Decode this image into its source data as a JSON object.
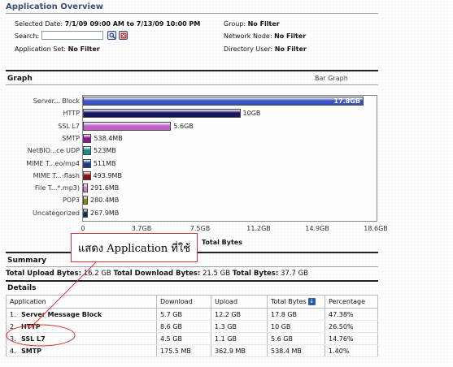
{
  "header": {
    "title": "Application Overview"
  },
  "filters": {
    "selected_date_label": "Selected Date:",
    "selected_date_value": "7/1/09 09:00 AM to 7/13/09 10:00 PM",
    "group_label": "Group:",
    "group_value": "No Filter",
    "search_label": "Search:",
    "search_value": "",
    "network_node_label": "Network Node:",
    "network_node_value": "No Filter",
    "application_set_label": "Application Set:",
    "application_set_value": "No Filter",
    "directory_user_label": "Directory User:",
    "directory_user_value": "No Filter"
  },
  "graph_section": {
    "title": "Graph",
    "view_option": "Bar Graph"
  },
  "chart_data": {
    "type": "bar",
    "orientation": "horizontal",
    "categories": [
      "Server... Block",
      "HTTP",
      "SSL L7",
      "SMTP",
      "NetBIO...ce UDP",
      "MIME T...eo/mp4",
      "MIME T...-flash",
      "File T...*.mp3)",
      "POP3",
      "Uncategorized"
    ],
    "values_gb": [
      17.8,
      10.0,
      5.6,
      0.5384,
      0.523,
      0.511,
      0.4939,
      0.2916,
      0.2804,
      0.2679
    ],
    "value_labels": [
      "17.8GB",
      "10GB",
      "5.6GB",
      "538.4MB",
      "523MB",
      "511MB",
      "493.9MB",
      "291.6MB",
      "280.4MB",
      "267.9MB"
    ],
    "colors": [
      "#3b52c4",
      "#16165e",
      "#c060c8",
      "#8a1a8a",
      "#178c8c",
      "#1a3a8a",
      "#8a1010",
      "#d080d0",
      "#8a8a10",
      "#102a55"
    ],
    "xticks": [
      "0",
      "3.7GB",
      "7.5GB",
      "11.2GB",
      "14.9GB",
      "18.6GB"
    ],
    "xlim": [
      0,
      18.6
    ],
    "xlabel": "Total Bytes",
    "ylabel": ""
  },
  "callout": {
    "text": "แสดง Application ที่ใช้",
    "border_color": "#e03030"
  },
  "summary": {
    "title": "Summary",
    "upload_label": "Total Upload Bytes:",
    "upload_value": "16.2 GB",
    "download_label": "Total Download Bytes:",
    "download_value": "21.5 GB",
    "total_label": "Total Bytes:",
    "total_value": "37.7 GB"
  },
  "details": {
    "title": "Details",
    "columns": [
      "Application",
      "Download",
      "Upload",
      "Total Bytes",
      "Percentage"
    ],
    "rows": [
      {
        "num": "1.",
        "app": "Server Message Block",
        "download": "5.7 GB",
        "upload": "12.2 GB",
        "total": "17.8 GB",
        "pct": "47.38%"
      },
      {
        "num": "2.",
        "app": "HTTP",
        "download": "8.6 GB",
        "upload": "1.3 GB",
        "total": "10 GB",
        "pct": "26.50%"
      },
      {
        "num": "3.",
        "app": "SSL L7",
        "download": "4.5 GB",
        "upload": "1.1 GB",
        "total": "5.6 GB",
        "pct": "14.76%"
      },
      {
        "num": "4.",
        "app": "SMTP",
        "download": "175.5 MB",
        "upload": "362.9 MB",
        "total": "538.4 MB",
        "pct": "1.40%"
      }
    ]
  }
}
